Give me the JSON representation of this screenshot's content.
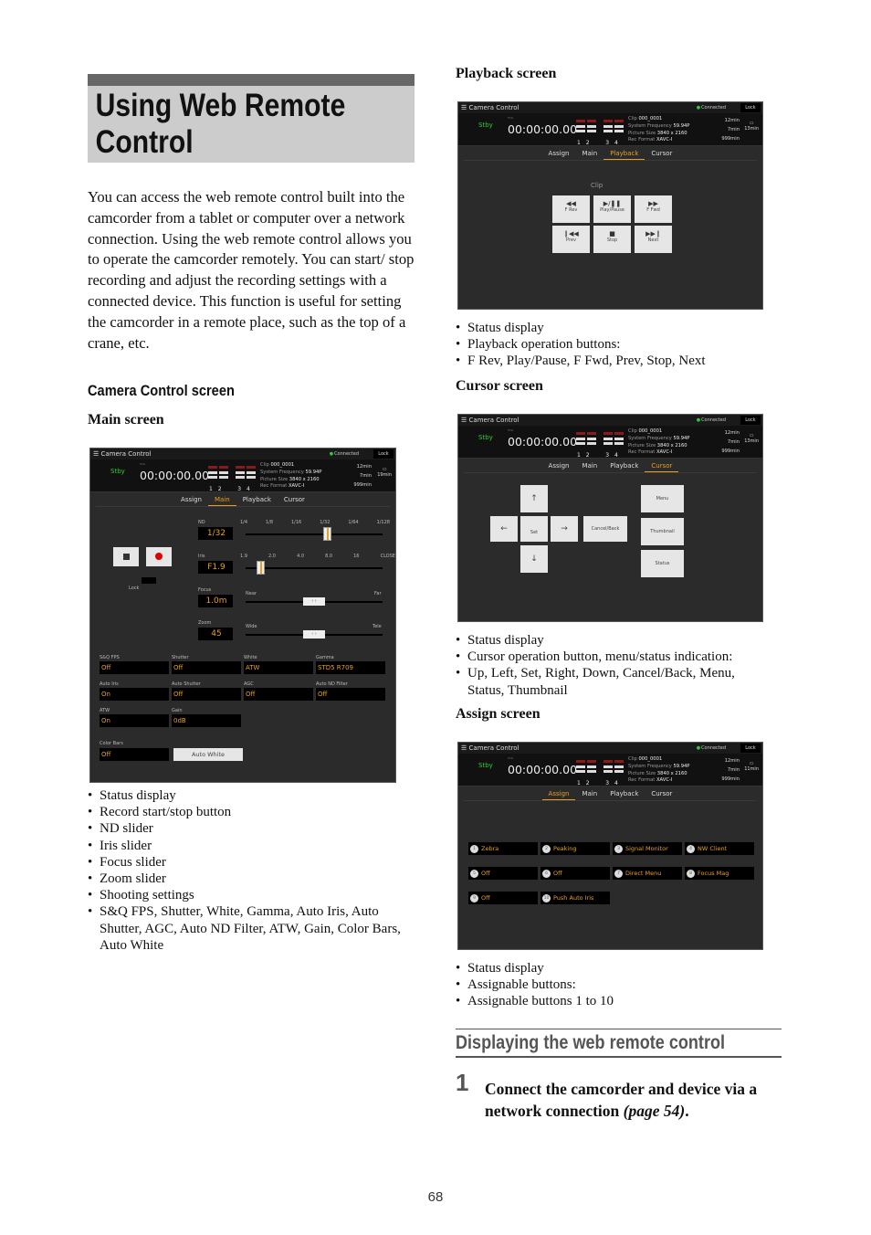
{
  "page": {
    "title": "Using Web Remote Control",
    "intro": "You can access the web remote control built into the camcorder from a tablet or computer over a network connection. Using the web remote control allows you to operate the camcorder remotely. You can start/ stop recording and adjust the recording settings with a connected device. This function is useful for setting the camcorder in a remote place, such as the top of a crane, etc.",
    "section_camera": "Camera Control screen",
    "main_screen_heading": "Main screen",
    "main_bullets": [
      "Status display",
      "Record start/stop button",
      "ND slider",
      "Iris slider",
      "Focus slider",
      "Zoom slider",
      "Shooting settings"
    ],
    "main_bullet_detail": "S&Q FPS, Shutter, White, Gamma, Auto Iris, Auto Shutter, AGC, Auto ND Filter, ATW, Gain, Color Bars, Auto White",
    "playback_heading": "Playback screen",
    "playback_bullets": [
      "Status display",
      "Playback operation buttons:"
    ],
    "playback_detail": "F Rev, Play/Pause, F Fwd, Prev, Stop, Next",
    "cursor_heading": "Cursor screen",
    "cursor_bullets": [
      "Status display",
      "Cursor operation button, menu/status indication:"
    ],
    "cursor_detail": "Up, Left, Set, Right, Down, Cancel/Back, Menu, Status, Thumbnail",
    "assign_heading": "Assign screen",
    "assign_bullets": [
      "Status display",
      "Assignable buttons:"
    ],
    "assign_detail": "Assignable buttons 1 to 10",
    "section_display": "Displaying the web remote control",
    "step_number": "1",
    "step_text": "Connect the camcorder and device via a network connection ",
    "step_ref": "(page 54)",
    "step_end": ".",
    "page_number": "68"
  },
  "app": {
    "title": "Camera Control",
    "connected": "Connected",
    "lock": "Lock",
    "stby": "Stby",
    "tc_label": "TCG",
    "timecode": "00:00:00.00",
    "channels": [
      "1",
      "2",
      "3",
      "4"
    ],
    "clip_label": "Clip",
    "clip": "000_0001",
    "freq_label": "System Frequency",
    "freq": "59.94P",
    "size_label": "Picture Size",
    "size": "3840 x 2160",
    "format_label": "Rec Format",
    "format": "XAVC-I",
    "media": [
      "12min",
      "7min",
      "999min"
    ],
    "tabs": [
      "Assign",
      "Main",
      "Playback",
      "Cursor"
    ]
  },
  "main_screen": {
    "battery": "19min",
    "nd": {
      "label": "ND",
      "value": "1/32",
      "ticks": [
        "1/4",
        "1/8",
        "1/16",
        "1/32",
        "1/64",
        "1/128"
      ]
    },
    "iris": {
      "label": "Iris",
      "value": "F1.9",
      "ticks": [
        "1.9",
        "2.0",
        "4.0",
        "8.0",
        "16",
        "CLOSE"
      ]
    },
    "focus": {
      "label": "Focus",
      "value": "1.0m",
      "left": "Near",
      "right": "Far"
    },
    "zoom": {
      "label": "Zoom",
      "value": "45",
      "left": "Wide",
      "right": "Tele"
    },
    "lock_label": "Lock",
    "settings": [
      {
        "label": "S&Q FPS",
        "value": "Off"
      },
      {
        "label": "Shutter",
        "value": "Off"
      },
      {
        "label": "White",
        "value": "ATW"
      },
      {
        "label": "Gamma",
        "value": "STD5 R709"
      },
      {
        "label": "Auto Iris",
        "value": "On"
      },
      {
        "label": "Auto Shutter",
        "value": "Off"
      },
      {
        "label": "AGC",
        "value": "Off"
      },
      {
        "label": "Auto ND Filter",
        "value": "Off"
      },
      {
        "label": "ATW",
        "value": "On"
      },
      {
        "label": "Gain",
        "value": "0dB"
      }
    ],
    "color_bars": {
      "label": "Color Bars",
      "value": "Off"
    },
    "auto_white": "Auto White"
  },
  "playback_screen": {
    "battery": "13min",
    "clip_heading": "Clip",
    "buttons": [
      {
        "icon": "◀◀",
        "label": "F Rev"
      },
      {
        "icon": "▶/❚❚",
        "label": "Play/Pause"
      },
      {
        "icon": "▶▶",
        "label": "F Fwd"
      },
      {
        "icon": "❙◀◀",
        "label": "Prev"
      },
      {
        "icon": "■",
        "label": "Stop"
      },
      {
        "icon": "▶▶❙",
        "label": "Next"
      }
    ]
  },
  "cursor_screen": {
    "battery": "13min",
    "up": "↑",
    "down": "↓",
    "left": "←",
    "right": "→",
    "set": "Set",
    "cancel": "Cancel/Back",
    "menu": "Menu",
    "thumbnail": "Thumbnail",
    "status": "Status"
  },
  "assign_screen": {
    "battery": "11min",
    "buttons": [
      {
        "n": "1",
        "label": "Zebra"
      },
      {
        "n": "2",
        "label": "Peaking"
      },
      {
        "n": "3",
        "label": "Signal Monitor"
      },
      {
        "n": "4",
        "label": "NW Client"
      },
      {
        "n": "5",
        "label": "Off"
      },
      {
        "n": "6",
        "label": "Off"
      },
      {
        "n": "7",
        "label": "Direct Menu"
      },
      {
        "n": "8",
        "label": "Focus Mag"
      },
      {
        "n": "9",
        "label": "Off"
      },
      {
        "n": "10",
        "label": "Push Auto Iris"
      }
    ]
  }
}
